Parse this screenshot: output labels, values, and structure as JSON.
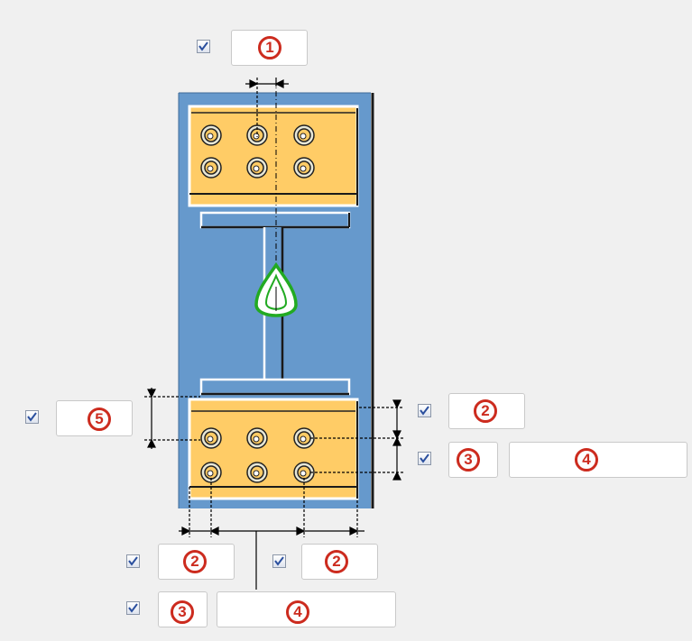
{
  "colors": {
    "background": "#f0f0f0",
    "column": "#6699cc",
    "plate": "#ffcc66",
    "beam": "#6699cc",
    "weld_symbol": "#22aa22",
    "badge": "#cc2b1e",
    "check": "#2a4f9e"
  },
  "parameters": [
    {
      "id": "p1",
      "badge": "1",
      "checked": true
    },
    {
      "id": "p5",
      "badge": "5",
      "checked": true
    },
    {
      "id": "p2-right",
      "badge": "2",
      "checked": true
    },
    {
      "id": "p3-right",
      "badge": "3",
      "checked": true
    },
    {
      "id": "p4-right",
      "badge": "4"
    },
    {
      "id": "p2-bottom-left",
      "badge": "2",
      "checked": true
    },
    {
      "id": "p2-bottom-right",
      "badge": "2",
      "checked": true
    },
    {
      "id": "p3-bottom",
      "badge": "3",
      "checked": true
    },
    {
      "id": "p4-bottom",
      "badge": "4"
    }
  ],
  "icons": {
    "bolt": "bolt-icon",
    "weld": "weld-symbol-icon",
    "check": "checkmark-icon"
  }
}
